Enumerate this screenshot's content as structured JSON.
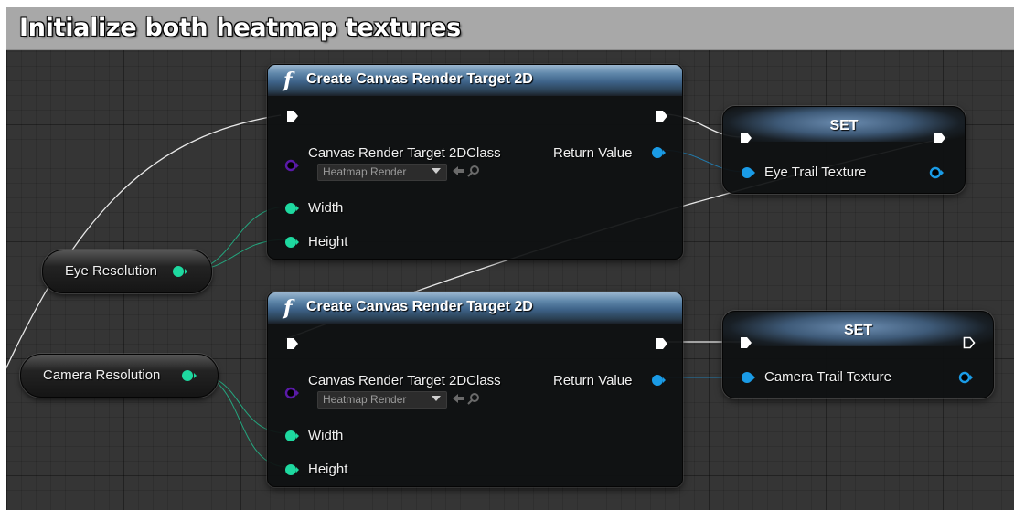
{
  "comment": {
    "title": "Initialize both heatmap textures"
  },
  "variables": {
    "eye_resolution": "Eye Resolution",
    "camera_resolution": "Camera Resolution"
  },
  "create_nodes": [
    {
      "title": "Create Canvas Render Target 2D",
      "class_label": "Canvas Render Target 2DClass",
      "class_value": "Heatmap Render",
      "return_label": "Return Value",
      "width_label": "Width",
      "height_label": "Height"
    },
    {
      "title": "Create Canvas Render Target 2D",
      "class_label": "Canvas Render Target 2DClass",
      "class_value": "Heatmap Render",
      "return_label": "Return Value",
      "width_label": "Width",
      "height_label": "Height"
    }
  ],
  "set_nodes": [
    {
      "title": "SET",
      "variable": "Eye Trail Texture"
    },
    {
      "title": "SET",
      "variable": "Camera Trail Texture"
    }
  ],
  "colors": {
    "object_pin": "#1a9be6",
    "struct_pin": "#1ed9a0",
    "class_pin": "#5a1aa8",
    "exec": "#ffffff",
    "function_header": "#3d6288"
  },
  "icons": [
    "function-icon",
    "exec-pin-icon",
    "dropdown-arrow-icon",
    "use-selected-icon",
    "browse-icon"
  ]
}
